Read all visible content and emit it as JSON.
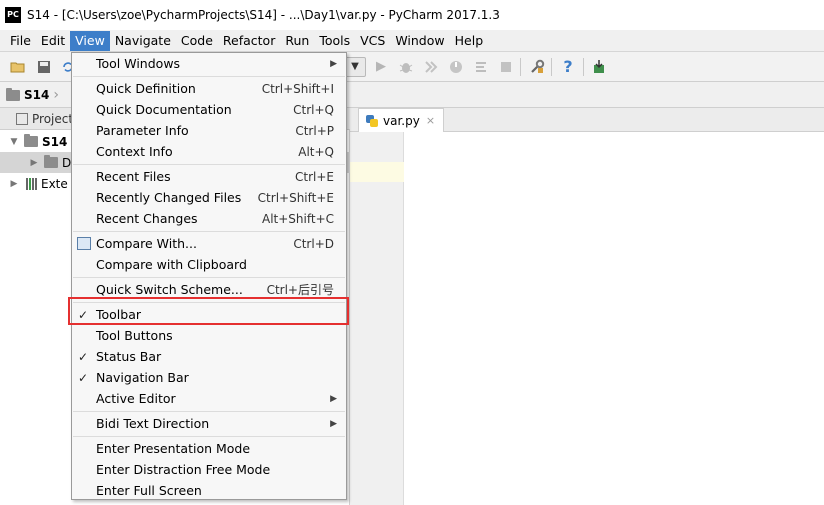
{
  "window": {
    "title": "S14 - [C:\\Users\\zoe\\PycharmProjects\\S14] - ...\\Day1\\var.py - PyCharm 2017.1.3",
    "app_icon_text": "PC"
  },
  "menubar": {
    "items": [
      "File",
      "Edit",
      "View",
      "Navigate",
      "Code",
      "Refactor",
      "Run",
      "Tools",
      "VCS",
      "Window",
      "Help"
    ],
    "active": "View"
  },
  "toolbar": {
    "icons": [
      "open-folder-icon",
      "save-icon",
      "sync-icon",
      "run-config-dropdown-icon",
      "run-icon",
      "debug-icon",
      "coverage-icon",
      "profile-icon",
      "concurrency-icon",
      "stop-icon",
      "settings-icon",
      "help-icon",
      "download-icon"
    ]
  },
  "navbar": {
    "crumb": "S14"
  },
  "project_panel": {
    "header": "Project",
    "tree": [
      {
        "label": "S14",
        "bold": true
      },
      {
        "label": "D"
      },
      {
        "label": "Exte"
      }
    ]
  },
  "editor": {
    "tab_label": "var.py",
    "tab_close": "×"
  },
  "view_menu": {
    "items": [
      {
        "label": "Tool Windows",
        "shortcut": "",
        "submenu": true
      },
      {
        "label": "Quick Definition",
        "shortcut": "Ctrl+Shift+I"
      },
      {
        "label": "Quick Documentation",
        "shortcut": "Ctrl+Q"
      },
      {
        "label": "Parameter Info",
        "shortcut": "Ctrl+P"
      },
      {
        "label": "Context Info",
        "shortcut": "Alt+Q"
      },
      {
        "label": "Recent Files",
        "shortcut": "Ctrl+E"
      },
      {
        "label": "Recently Changed Files",
        "shortcut": "Ctrl+Shift+E"
      },
      {
        "label": "Recent Changes",
        "shortcut": "Alt+Shift+C"
      },
      {
        "label": "Compare With...",
        "shortcut": "Ctrl+D"
      },
      {
        "label": "Compare with Clipboard",
        "shortcut": ""
      },
      {
        "label": "Quick Switch Scheme...",
        "shortcut": "Ctrl+后引号"
      },
      {
        "label": "Toolbar",
        "shortcut": "",
        "checked": true
      },
      {
        "label": "Tool Buttons",
        "shortcut": ""
      },
      {
        "label": "Status Bar",
        "shortcut": "",
        "checked": true
      },
      {
        "label": "Navigation Bar",
        "shortcut": "",
        "checked": true
      },
      {
        "label": "Active Editor",
        "shortcut": "",
        "submenu": true
      },
      {
        "label": "Bidi Text Direction",
        "shortcut": "",
        "submenu": true
      },
      {
        "label": "Enter Presentation Mode",
        "shortcut": ""
      },
      {
        "label": "Enter Distraction Free Mode",
        "shortcut": ""
      },
      {
        "label": "Enter Full Screen",
        "shortcut": ""
      }
    ],
    "check_glyph": "✓",
    "submenu_glyph": "▶"
  },
  "colors": {
    "menu_active": "#3d7ec9",
    "highlight_box": "#e53030"
  }
}
